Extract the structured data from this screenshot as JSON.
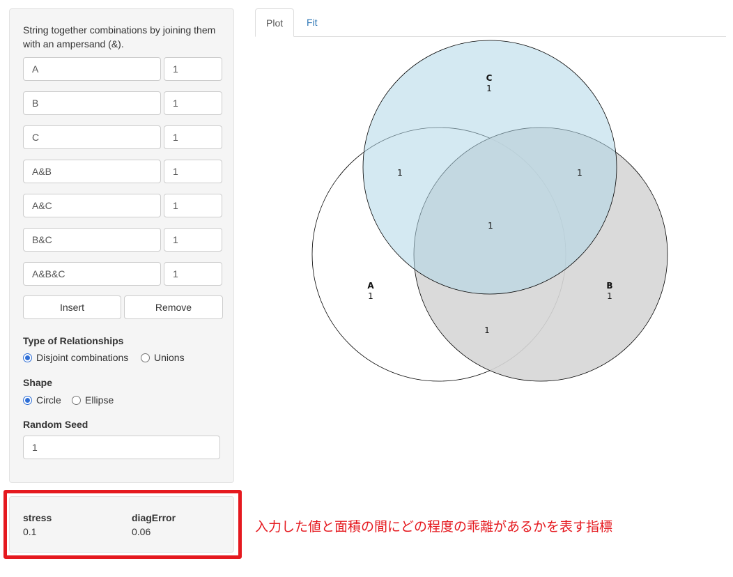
{
  "sidebar": {
    "instruction": "String together combinations by joining them with an ampersand (&).",
    "combinations": [
      {
        "name": "A",
        "value": "1"
      },
      {
        "name": "B",
        "value": "1"
      },
      {
        "name": "C",
        "value": "1"
      },
      {
        "name": "A&B",
        "value": "1"
      },
      {
        "name": "A&C",
        "value": "1"
      },
      {
        "name": "B&C",
        "value": "1"
      },
      {
        "name": "A&B&C",
        "value": "1"
      }
    ],
    "insert_label": "Insert",
    "remove_label": "Remove",
    "relationship": {
      "label": "Type of Relationships",
      "options": [
        "Disjoint combinations",
        "Unions"
      ],
      "selected": "Disjoint combinations"
    },
    "shape": {
      "label": "Shape",
      "options": [
        "Circle",
        "Ellipse"
      ],
      "selected": "Circle"
    },
    "seed": {
      "label": "Random Seed",
      "value": "1"
    }
  },
  "metrics": {
    "stress_label": "stress",
    "stress_value": "0.1",
    "diag_label": "diagError",
    "diag_value": "0.06"
  },
  "annotation": "入力した値と面積の間にどの程度の乖離があるかを表す指標",
  "tabs": {
    "plot": "Plot",
    "fit": "Fit",
    "active": "Plot"
  },
  "venn": {
    "sets": [
      {
        "name": "A",
        "count": "1",
        "fill": "#ffffff"
      },
      {
        "name": "B",
        "count": "1",
        "fill": "#d6d6d6"
      },
      {
        "name": "C",
        "count": "1",
        "fill": "#b1d7e8"
      }
    ],
    "regions": {
      "A&C": "1",
      "B&C": "1",
      "A&B&C": "1",
      "A&B": "1"
    }
  },
  "colors": {
    "accent": "#2f6fd6",
    "link": "#337ab7",
    "annotation": "#e5191f"
  }
}
